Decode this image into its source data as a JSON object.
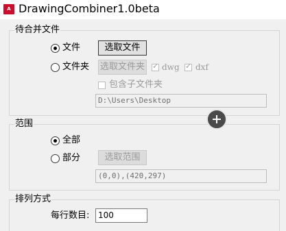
{
  "window": {
    "title": "DrawingCombiner1.0beta",
    "icon_text": "A",
    "icon_color": "#c8102e"
  },
  "merge_group": {
    "label": "待合并文件",
    "file_radio_label": "文件",
    "file_radio_checked": true,
    "select_file_button": "选取文件",
    "folder_radio_label": "文件夹",
    "folder_radio_checked": false,
    "select_folder_button": "选取文件夹",
    "dwg_label": "dwg",
    "dwg_checked": true,
    "dxf_label": "dxf",
    "dxf_checked": true,
    "include_subfolders_label": "包含子文件夹",
    "include_subfolders_checked": false,
    "path_value": "D:\\Users\\Desktop"
  },
  "range_group": {
    "label": "范围",
    "all_radio_label": "全部",
    "all_radio_checked": true,
    "partial_radio_label": "部分",
    "partial_radio_checked": false,
    "select_range_button": "选取范围",
    "range_value": "(0,0),(420,297)"
  },
  "arrange_group": {
    "label": "排列方式",
    "per_row_label": "每行数目:",
    "per_row_value": "100"
  }
}
